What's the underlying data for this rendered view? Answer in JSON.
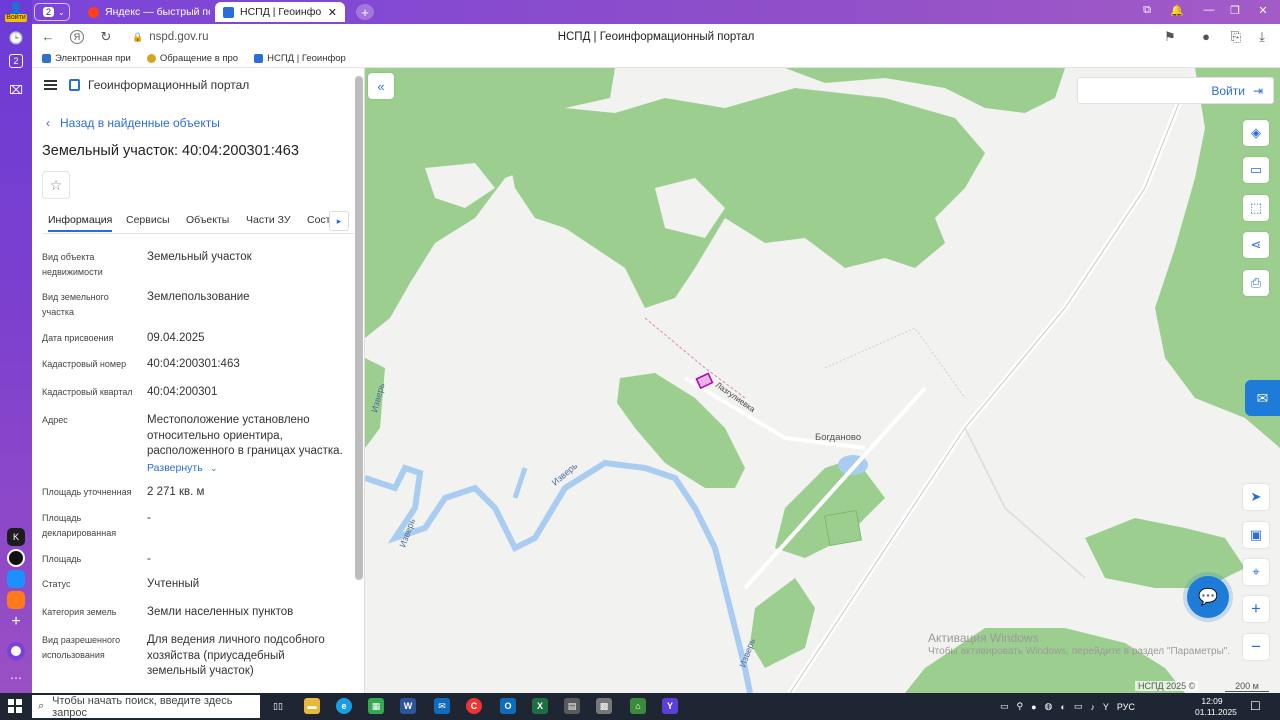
{
  "rail": {
    "profile_label": "Войти",
    "tab_count": "2",
    "badge_count": "2"
  },
  "browser": {
    "tabs": [
      {
        "label": "Яндекс — быстрый поиск",
        "active": false
      },
      {
        "label": "НСПД | Геоинформационный",
        "active": true
      }
    ],
    "tab_group_count": "2",
    "url": "nspd.gov.ru",
    "page_title": "НСПД | Геоинформационный портал",
    "bookmarks": [
      "Электронная при",
      "Обращение в про",
      "НСПД | Геоинфор"
    ]
  },
  "panel": {
    "brand": "Геоинформационный портал",
    "back_link": "Назад в найденные объекты",
    "title": "Земельный участок: 40:04:200301:463",
    "tabs": [
      "Информация",
      "Сервисы",
      "Объекты",
      "Части ЗУ",
      "Соста"
    ],
    "fields": [
      {
        "key": "Вид объекта недвижимости",
        "value": "Земельный участок"
      },
      {
        "key": "Вид земельного участка",
        "value": "Землепользование"
      },
      {
        "key": "Дата присвоения",
        "value": "09.04.2025"
      },
      {
        "key": "Кадастровый номер",
        "value": "40:04:200301:463"
      },
      {
        "key": "Кадастровый квартал",
        "value": "40:04:200301"
      },
      {
        "key": "Адрес",
        "value": "Местоположение установлено относительно ориентира, расположенного в границах участка."
      },
      {
        "key": "Площадь уточненная",
        "value": "2 271 кв. м"
      },
      {
        "key": "Площадь декларированная",
        "value": "-"
      },
      {
        "key": "Площадь",
        "value": "-"
      },
      {
        "key": "Статус",
        "value": "Учтенный"
      },
      {
        "key": "Категория земель",
        "value": "Земли населенных пунктов"
      },
      {
        "key": "Вид разрешенного использования",
        "value": "Для ведения личного подсобного хозяйства (приусадебный земельный участок)"
      }
    ],
    "expand_label": "Развернуть"
  },
  "map": {
    "login_label": "Войти",
    "labels": {
      "river1": "Изверь",
      "river2": "Изверь",
      "river3": "Изверь",
      "river4": "Изверь",
      "village": "Богданово",
      "street": "Лазгулиевка"
    },
    "activation_title": "Активация Windows",
    "activation_text": "Чтобы активировать Windows, перейдите в раздел \"Параметры\".",
    "copyright": "НСПД 2025 ©",
    "scale": "200 м",
    "colors": {
      "forest": "#9ccf8f",
      "water": "#a8cdf0",
      "accent": "#2a6dd9",
      "parcel": "#b000b0"
    }
  },
  "taskbar": {
    "search_placeholder": "Чтобы начать поиск, введите здесь запрос",
    "lang": "РУС",
    "time": "12:09",
    "date": "01.11.2025"
  }
}
